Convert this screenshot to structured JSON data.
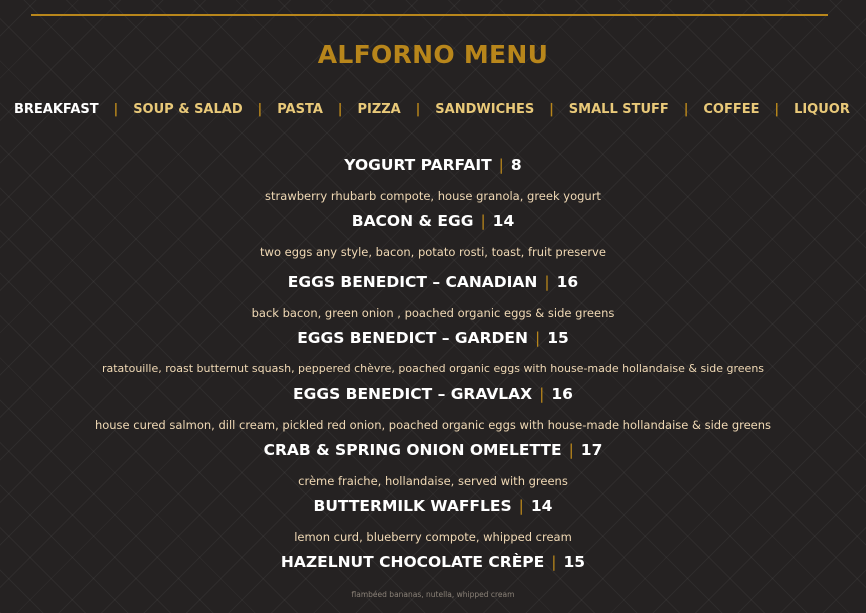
{
  "header": {
    "title": "ALFORNO MENU"
  },
  "nav": {
    "items": [
      {
        "label": "BREAKFAST",
        "active": true
      },
      {
        "label": "SOUP & SALAD"
      },
      {
        "label": "PASTA"
      },
      {
        "label": "PIZZA"
      },
      {
        "label": "SANDWICHES"
      },
      {
        "label": "SMALL STUFF"
      },
      {
        "label": "COFFEE"
      },
      {
        "label": "LIQUOR"
      }
    ],
    "separator": "|"
  },
  "menu": {
    "items": [
      {
        "name": "YOGURT PARFAIT",
        "price": "8",
        "description": "strawberry rhubarb compote, house granola, greek yogurt"
      },
      {
        "name": "BACON & EGG",
        "price": "14",
        "description": "two eggs any style, bacon, potato rosti, toast, fruit preserve"
      },
      {
        "name": "EGGS BENEDICT – CANADIAN",
        "price": "16",
        "description": "back bacon, green onion , poached organic eggs & side greens"
      },
      {
        "name": "EGGS BENEDICT – GARDEN",
        "price": "15",
        "description": "ratatouille, roast butternut squash, peppered chèvre, poached organic eggs with house-made hollandaise & side greens"
      },
      {
        "name": "EGGS BENEDICT – GRAVLAX",
        "price": "16",
        "description": "house cured salmon, dill cream, pickled red onion, poached organic eggs  with house-made hollandaise & side greens"
      },
      {
        "name": "CRAB & SPRING ONION OMELETTE",
        "price": "17",
        "description": "crème fraiche, hollandaise, served with greens"
      },
      {
        "name": "BUTTERMILK WAFFLES",
        "price": "14",
        "description": "lemon curd, blueberry compote, whipped cream"
      },
      {
        "name": "HAZELNUT CHOCOLATE CRÈPE",
        "price": "15",
        "description": "flambéed bananas, nutella, whipped cream"
      }
    ]
  },
  "colors": {
    "accent": "#b8861b",
    "background": "#252222",
    "nav_text": "#e9c979",
    "description_text": "#f0d9b5"
  }
}
